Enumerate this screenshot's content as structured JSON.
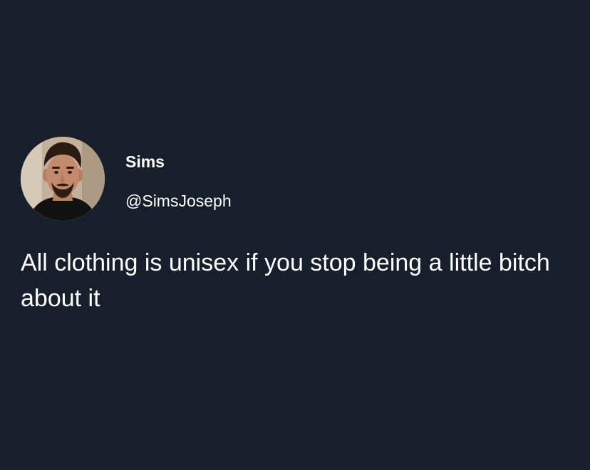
{
  "tweet": {
    "author": {
      "display_name": "Sims",
      "handle": "@SimsJoseph",
      "avatar_icon": "profile-photo"
    },
    "text": "All clothing is unisex if you stop being a little bitch about it"
  },
  "colors": {
    "background": "#161f2b",
    "text": "#ffffff"
  }
}
